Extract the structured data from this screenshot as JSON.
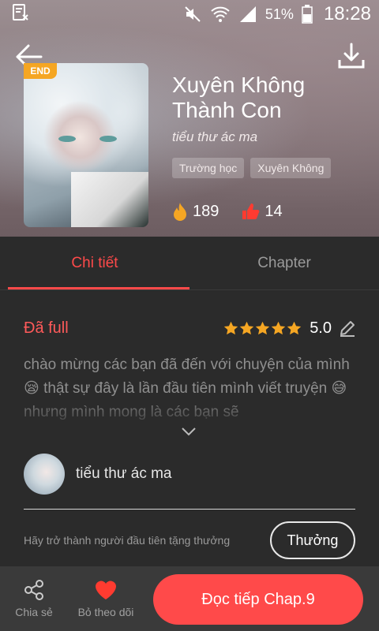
{
  "status_bar": {
    "battery": "51%",
    "time": "18:28"
  },
  "book": {
    "badge": "END",
    "title": "Xuyên Không Thành Con",
    "author": "tiểu thư ác ma",
    "tags": [
      "Trường học",
      "Xuyên Không"
    ],
    "views": "189",
    "likes": "14"
  },
  "tabs": [
    {
      "label": "Chi tiết",
      "active": true
    },
    {
      "label": "Chapter",
      "active": false
    }
  ],
  "details": {
    "status": "Đã full",
    "rating_stars": 5,
    "rating_value": "5.0",
    "description": "chào mừng các bạn đã đến với chuyện của mình 😪 thật sự đây là lần đầu tiên mình viết truyện 😅 nhưng mình mong là các bạn sẽ"
  },
  "author_row": {
    "name": "tiểu thư ác ma"
  },
  "reward": {
    "text": "Hãy trở thành người đầu tiên tặng thưởng",
    "button": "Thưởng"
  },
  "bottom_bar": {
    "share_label": "Chia sẻ",
    "unfollow_label": "Bỏ theo dõi",
    "read_label": "Đọc tiếp Chap.9"
  },
  "colors": {
    "accent": "#ff4a4a",
    "badge": "#f5a623",
    "fire": "#f5a623"
  }
}
